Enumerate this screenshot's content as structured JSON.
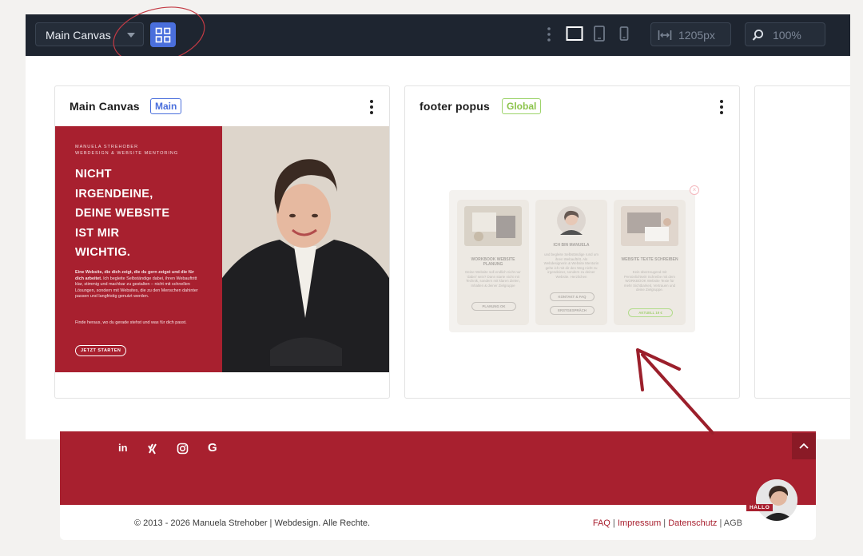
{
  "toolbar": {
    "canvas_select_value": "Main Canvas",
    "width_value": "1205px",
    "zoom_value": "100%",
    "colors": {
      "bg": "#1e2530",
      "accent": "#4a6fdc"
    },
    "icons": [
      "chevron-down-icon",
      "grid-icon",
      "more-vertical-icon",
      "desktop-icon",
      "tablet-icon",
      "mobile-icon",
      "width-icon",
      "zoom-icon"
    ]
  },
  "cards": [
    {
      "title": "Main Canvas",
      "badge": "Main",
      "hero": {
        "brand_line1": "MANUELA STREHOBER",
        "brand_line2": "WEBDESIGN & WEBSITE MENTORING",
        "headline": [
          "NICHT",
          "IRGENDEINE,",
          "DEINE WEBSITE",
          "IST MIR",
          "WICHTIG."
        ],
        "copy_bold": "Eine Website, die dich zeigt, die du gern zeigst und die für dich arbeitet.",
        "copy": "Ich begleite Selbständige dabei, ihren Webauftritt klar, stimmig und machbar zu gestalten – nicht mit schnellen Lösungen, sondern mit Websites, die zu den Menschen dahinter passen und langfristig genutzt werden.",
        "copy2": "Finde heraus, wo du gerade stehst und was für dich passt.",
        "cta": "JETZT STARTEN"
      }
    },
    {
      "title": "footer popus",
      "badge": "Global",
      "popup": {
        "columns": [
          {
            "title": "WORKBOOK WEBSITE PLANUNG",
            "text": "Deine Website soll endlich nicht nur 'dabei' sein? Dann starte nicht mit Technik, sondern mit klaren Zielen, Inhalten & deiner Zielgruppe",
            "buttons": [
              "PLANUNG OK"
            ]
          },
          {
            "title": "ICH BIN MANUELA",
            "text": "und begleite Selbständige rund um ihren Webauftritt. Als Webdesignerin & Website Mentorin gehe ich mit dir den Weg nicht zu irgendeiner, sondern zu deiner Website. Herzlichen",
            "buttons": [
              "KONTAKT & FAQ",
              "ERSTGESPRÄCH"
            ]
          },
          {
            "title": "WEBSITE TEXTE SCHREIBEN",
            "text": "Kein überzeugend mit Persönlichkeit! Schreibe mit dem WORKBOOK Website Texte für mehr Sichtbarkeit, Vertrauen und deine Zielgruppe.",
            "buttons": [
              "AKTUELL 19 €"
            ]
          }
        ]
      }
    }
  ],
  "footer": {
    "social": [
      "linkedin-icon",
      "xing-icon",
      "instagram-icon",
      "google-icon"
    ],
    "copyright": "© 2013 - 2026 Manuela Strehober | Webdesign. Alle Rechte.",
    "links": [
      "FAQ",
      "Impressum",
      "Datenschutz",
      "AGB"
    ],
    "hallo": "HALLO",
    "colors": {
      "brand": "#a8202f"
    }
  }
}
